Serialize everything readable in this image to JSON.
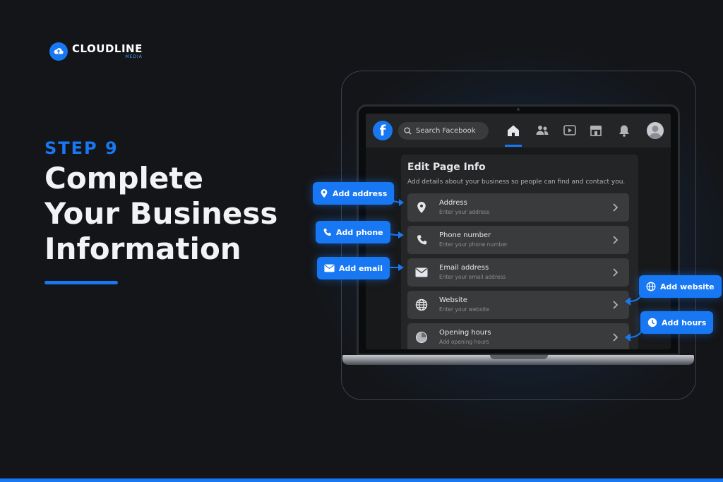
{
  "brand": {
    "name": "CLOUDLINE",
    "sub": "MEDIA"
  },
  "hero": {
    "step": "STEP 9",
    "headline": [
      "Complete",
      "Your Business",
      "Information"
    ]
  },
  "facebook": {
    "search_placeholder": "Search Facebook",
    "nav_icons": [
      "home-icon",
      "friends-icon",
      "watch-icon",
      "marketplace-icon",
      "bell-icon"
    ],
    "panel": {
      "title": "Edit Page Info",
      "description": "Add details about your business so people can find and contact you.",
      "rows": [
        {
          "label": "Address",
          "sub": "Enter your address",
          "icon": "location-pin-icon"
        },
        {
          "label": "Phone number",
          "sub": "Enter your phone number",
          "icon": "phone-icon"
        },
        {
          "label": "Email address",
          "sub": "Enter your email address",
          "icon": "envelope-icon"
        },
        {
          "label": "Website",
          "sub": "Enter your website",
          "icon": "globe-icon"
        },
        {
          "label": "Opening hours",
          "sub": "Add opening hours",
          "icon": "clock-icon"
        }
      ]
    }
  },
  "callouts": {
    "address": "Add address",
    "phone": "Add phone",
    "email": "Add email",
    "website": "Add website",
    "hours": "Add hours"
  },
  "colors": {
    "accent": "#1877f2",
    "background": "#141518",
    "panel": "#242526",
    "row": "#3a3b3c"
  }
}
